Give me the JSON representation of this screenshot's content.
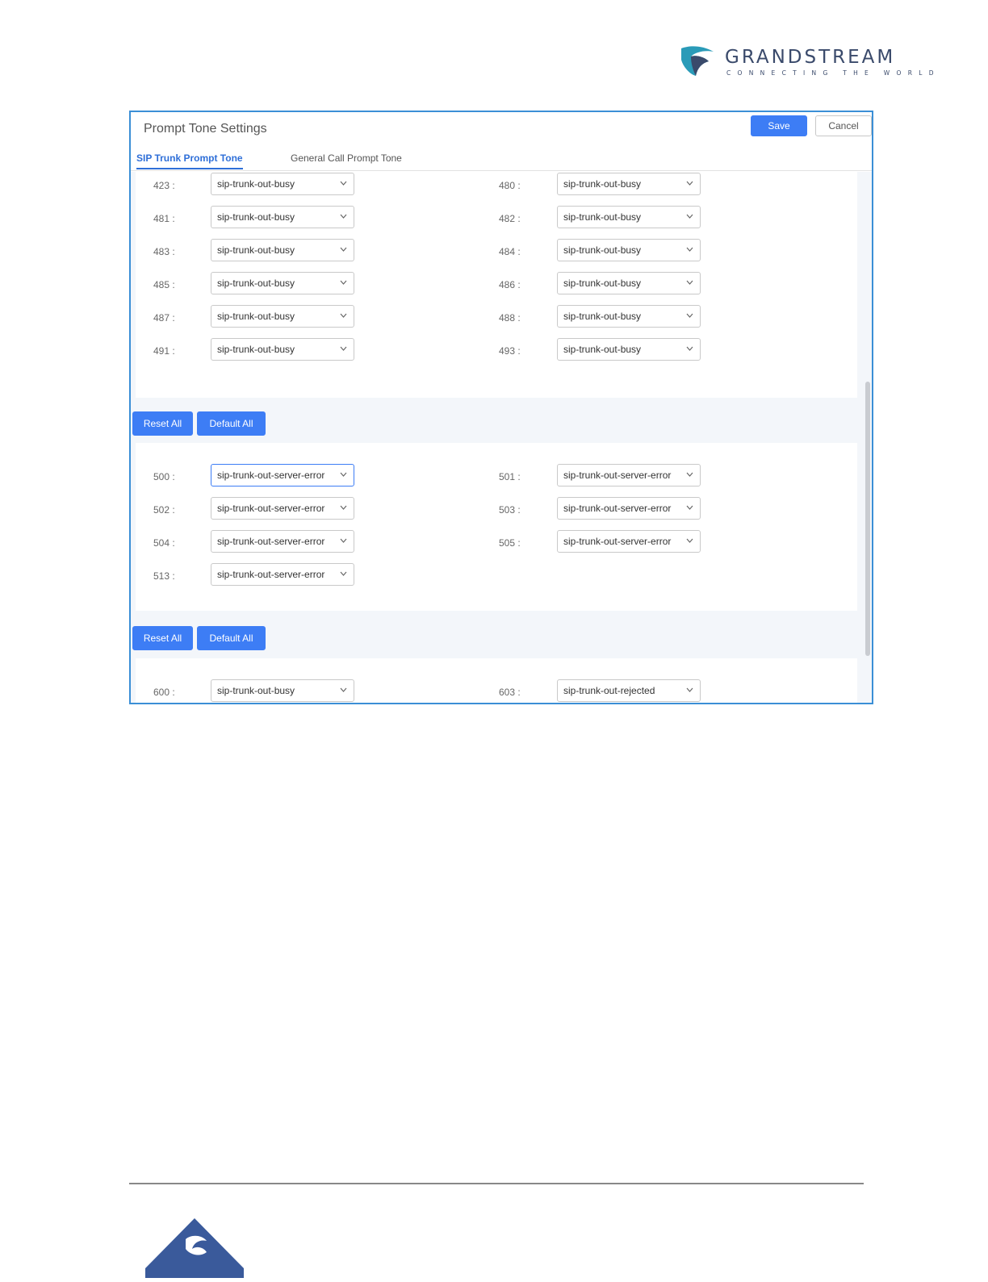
{
  "brand": {
    "name": "GRANDSTREAM",
    "tagline": "CONNECTING THE WORLD",
    "colors": {
      "navy": "#3a4a6b",
      "teal": "#2a9bb8"
    }
  },
  "dialog": {
    "title": "Prompt Tone Settings",
    "save_label": "Save",
    "cancel_label": "Cancel",
    "tabs": [
      {
        "label": "SIP Trunk Prompt Tone",
        "active": true
      },
      {
        "label": "General Call Prompt Tone",
        "active": false
      }
    ]
  },
  "section_4xx": {
    "rows": [
      {
        "left_code": "423 :",
        "left_value": "sip-trunk-out-busy",
        "right_code": "480 :",
        "right_value": "sip-trunk-out-busy"
      },
      {
        "left_code": "481 :",
        "left_value": "sip-trunk-out-busy",
        "right_code": "482 :",
        "right_value": "sip-trunk-out-busy"
      },
      {
        "left_code": "483 :",
        "left_value": "sip-trunk-out-busy",
        "right_code": "484 :",
        "right_value": "sip-trunk-out-busy"
      },
      {
        "left_code": "485 :",
        "left_value": "sip-trunk-out-busy",
        "right_code": "486 :",
        "right_value": "sip-trunk-out-busy"
      },
      {
        "left_code": "487 :",
        "left_value": "sip-trunk-out-busy",
        "right_code": "488 :",
        "right_value": "sip-trunk-out-busy"
      },
      {
        "left_code": "491 :",
        "left_value": "sip-trunk-out-busy",
        "right_code": "493 :",
        "right_value": "sip-trunk-out-busy"
      }
    ],
    "reset_label": "Reset All",
    "default_label": "Default All"
  },
  "section_5xx": {
    "rows": [
      {
        "left_code": "500 :",
        "left_value": "sip-trunk-out-server-error",
        "right_code": "501 :",
        "right_value": "sip-trunk-out-server-error"
      },
      {
        "left_code": "502 :",
        "left_value": "sip-trunk-out-server-error",
        "right_code": "503 :",
        "right_value": "sip-trunk-out-server-error"
      },
      {
        "left_code": "504 :",
        "left_value": "sip-trunk-out-server-error",
        "right_code": "505 :",
        "right_value": "sip-trunk-out-server-error"
      },
      {
        "left_code": "513 :",
        "left_value": "sip-trunk-out-server-error"
      }
    ],
    "reset_label": "Reset All",
    "default_label": "Default All"
  },
  "section_6xx": {
    "rows": [
      {
        "left_code": "600 :",
        "left_value": "sip-trunk-out-busy",
        "right_code": "603 :",
        "right_value": "sip-trunk-out-rejected"
      }
    ]
  },
  "colors": {
    "accent": "#3d7df5",
    "frame": "#3b8fd6",
    "tab_active": "#2f6fd8"
  }
}
